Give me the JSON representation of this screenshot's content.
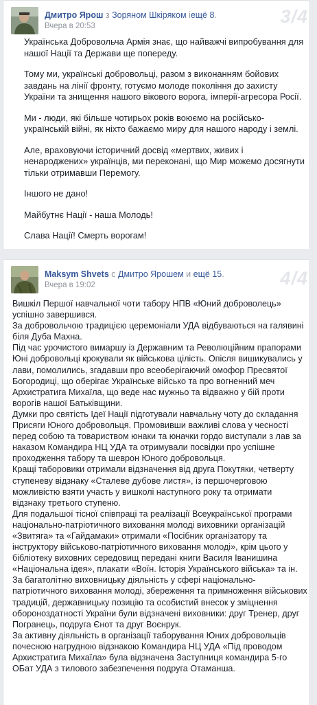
{
  "posts": [
    {
      "author": "Дмитро Ярош",
      "with_word": "з",
      "tagged_person": "Зоряном Шкiряком",
      "and_word": "і",
      "others": "ещё 8",
      "time": "Вчера в 20:53",
      "watermark": "3/4",
      "paragraphs": [
        "Українська Добровольча Армія знає, що найважчі випробування для нашої Нації та Держави ще попереду.",
        "Тому ми, українські добровольці, разом з виконанням бойових завдань на лінії фронту, готуємо молоде покоління до захисту України та знищення нашого вікового ворога, імперії-агресора Росії.",
        "Ми - люди, які більше чотирьох років воюємо на російсько-українській війні, як ніхто бажаємо миру для нашого народу і землі.",
        "Але, враховуючи історичний досвід «мертвих, живих і ненароджених» українців, ми переконані, що Мир можемо досягнути тільки отримавши Перемогу.",
        "Іншого не дано!",
        "Майбутнє Нації - наша Молодь!",
        "Слава Нації! Смерть ворогам!"
      ]
    },
    {
      "author": "Maksym Shvets",
      "with_word": "с",
      "tagged_person": "Дмитро Ярошем",
      "and_word": "и",
      "others": "ещё 15",
      "time": "Вчера в 19:02",
      "watermark": "4/4",
      "paragraphs": [
        "Вишкіл Першої навчальної чоти табору НПВ «Юний доброволець» успішно завершився.",
        "За добровольчою традицією церемоніали УДА відбуваються на галявині біля Дуба Махна.",
        "Під час урочистого вимаршу із Державним та Революційним прапорами Юні добровольці крокували як військова цілість. Опісля вишикувались у лави, помолились, згадавши про всеоберігаючий омофор Пресвятої Богородиці, що оберігає Українське військо та про вогненний меч Архистратига Михаїла, що веде нас мужньо та відважно у бій проти ворогів нашої Батьківщини.",
        "Думки про святість Ідеї Нації підготували навчальну чоту до складання Присяги Юного добровольця. Промовивши важливі слова у чесності перед собою та товариством юнаки та юначки гордо виступали з лав за наказом Командира НЦ УДА та отримували посвідки про успішне проходження табору та шеврон Юного добровольця.",
        "Кращі таборовики отримали відзначення від друга Покутяки, четверту ступеневу відзнаку «Сталеве дубове листя», із першочерговою можливістю взяти участь у вишколі наступного року та отримати відзнаку третього ступеню.",
        "Для подальшої тісної співпраці та реалізації Всеукраїнської програми національно-патріотичного виховання молоді виховники організацій «Звитяга» та «Гайдамаки» отримали «Посібник організатору та інструктору військово-патріотичного виховання молоді», крім цього у бібліотеку виховних середовищ передані книги Василя Іванишина «Національна ідея», плакати «Воїн. Історія Українського війська» та ін.",
        "За багатолітню виховницьку діяльність у сфері національно-патріотичного виховання молоді, збереження та примноження військових традицій, державницьку позицію та особистий внесок у зміцнення обороноздатності України були відзначені виховники: друг Тренер, друг Погранець, подруга Єнот та друг Воєнрук.",
        "За активну діяльність в організації таборування Юних добровольців почесною нагрудною відзнакою Командира НЦ УДА «Під проводом Архистратига Михаїла» була відзначена Заступниця командира 5-го ОБат УДА з тилового забезпечення подруга Отаманша."
      ]
    }
  ]
}
